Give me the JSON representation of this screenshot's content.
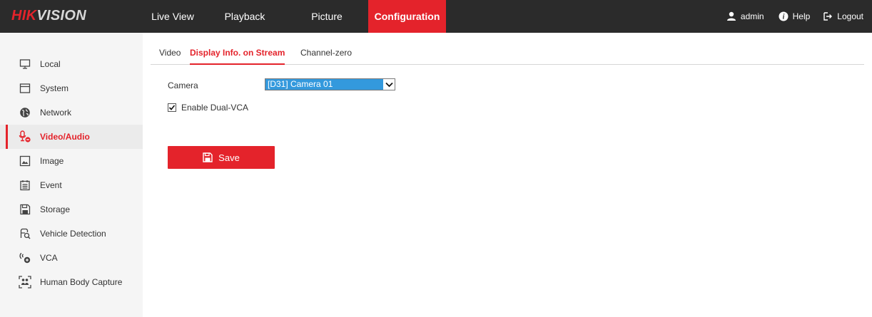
{
  "brand": {
    "logo_part1": "HIK",
    "logo_part2": "VISION"
  },
  "nav": {
    "items": [
      {
        "label": "Live View"
      },
      {
        "label": "Playback"
      },
      {
        "label": "Picture"
      },
      {
        "label": "Configuration",
        "active": true
      }
    ]
  },
  "header_right": {
    "user": "admin",
    "help": "Help",
    "logout": "Logout"
  },
  "sidebar": {
    "items": [
      {
        "label": "Local",
        "icon": "monitor-icon"
      },
      {
        "label": "System",
        "icon": "system-icon"
      },
      {
        "label": "Network",
        "icon": "globe-icon"
      },
      {
        "label": "Video/Audio",
        "icon": "microphone-icon",
        "active": true
      },
      {
        "label": "Image",
        "icon": "image-icon"
      },
      {
        "label": "Event",
        "icon": "calendar-icon"
      },
      {
        "label": "Storage",
        "icon": "storage-icon"
      },
      {
        "label": "Vehicle Detection",
        "icon": "vehicle-detection-icon"
      },
      {
        "label": "VCA",
        "icon": "vca-icon"
      },
      {
        "label": "Human Body Capture",
        "icon": "human-body-capture-icon"
      }
    ]
  },
  "tabs": [
    {
      "label": "Video"
    },
    {
      "label": "Display Info. on Stream",
      "active": true
    },
    {
      "label": "Channel-zero"
    }
  ],
  "form": {
    "camera_label": "Camera",
    "camera_value": "[D31] Camera 01",
    "dual_vca_label": "Enable Dual-VCA",
    "dual_vca_checked": true,
    "save_label": "Save"
  },
  "colors": {
    "accent": "#e4232b",
    "topbar": "#2b2b2b",
    "sidebar": "#f5f5f5",
    "select_highlight": "#3399dd"
  }
}
